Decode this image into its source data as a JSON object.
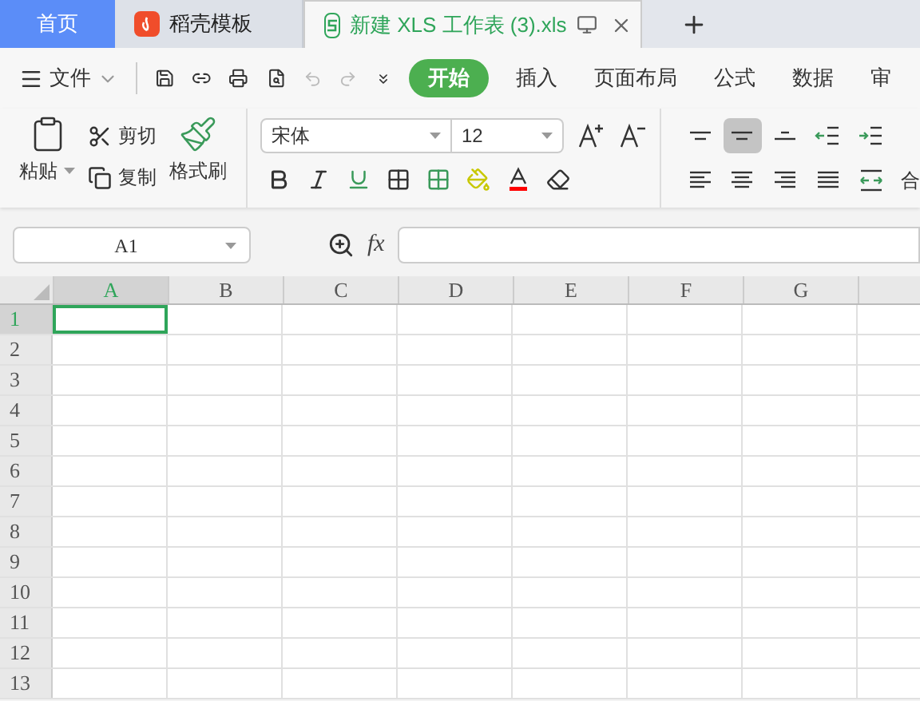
{
  "tabs": [
    {
      "label": "首页",
      "kind": "home",
      "selected": false
    },
    {
      "label": "稻壳模板",
      "kind": "docer",
      "selected": false
    },
    {
      "label": "新建 XLS 工作表 (3).xls",
      "kind": "sheet",
      "selected": true
    }
  ],
  "menu": {
    "file": "文件",
    "items": [
      {
        "label": "开始",
        "selected": true
      },
      {
        "label": "插入",
        "selected": false
      },
      {
        "label": "页面布局",
        "selected": false
      },
      {
        "label": "公式",
        "selected": false
      },
      {
        "label": "数据",
        "selected": false
      },
      {
        "label": "审",
        "selected": false
      }
    ]
  },
  "ribbon": {
    "paste": "粘贴",
    "cut": "剪切",
    "copy": "复制",
    "format_painter": "格式刷",
    "font_name": "宋体",
    "font_size": "12",
    "alignment": [
      {
        "kind": "top",
        "selected": false
      },
      {
        "kind": "middle",
        "selected": true
      },
      {
        "kind": "bottom",
        "selected": false
      },
      {
        "kind": "outdent",
        "selected": false
      },
      {
        "kind": "indent",
        "selected": false
      },
      {
        "kind": "left",
        "selected": false
      },
      {
        "kind": "center",
        "selected": false
      },
      {
        "kind": "right",
        "selected": false
      },
      {
        "kind": "justify",
        "selected": false
      },
      {
        "kind": "distributed",
        "selected": false
      }
    ],
    "cut_off_label": "合"
  },
  "formula_bar": {
    "cell_ref": "A1",
    "fx": "fx"
  },
  "grid": {
    "columns": [
      {
        "label": "A",
        "selected": true
      },
      {
        "label": "B",
        "selected": false
      },
      {
        "label": "C",
        "selected": false
      },
      {
        "label": "D",
        "selected": false
      },
      {
        "label": "E",
        "selected": false
      },
      {
        "label": "F",
        "selected": false
      },
      {
        "label": "G",
        "selected": false
      }
    ],
    "rows": [
      {
        "label": "1",
        "selected": true
      },
      {
        "label": "2",
        "selected": false
      },
      {
        "label": "3",
        "selected": false
      },
      {
        "label": "4",
        "selected": false
      },
      {
        "label": "5",
        "selected": false
      },
      {
        "label": "6",
        "selected": false
      },
      {
        "label": "7",
        "selected": false
      },
      {
        "label": "8",
        "selected": false
      },
      {
        "label": "9",
        "selected": false
      },
      {
        "label": "10",
        "selected": false
      },
      {
        "label": "11",
        "selected": false
      },
      {
        "label": "12",
        "selected": false
      },
      {
        "label": "13",
        "selected": false
      }
    ]
  }
}
